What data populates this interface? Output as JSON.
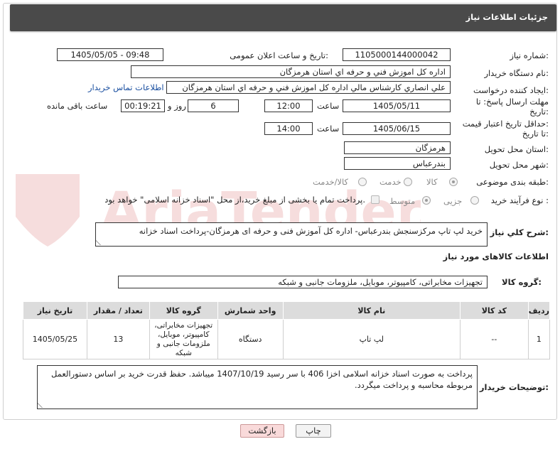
{
  "header": {
    "title": "جزئیات اطلاعات نیاز"
  },
  "fields": {
    "need_number_label": "شماره نیاز:",
    "need_number": "1105000144000042",
    "announce_label": "تاریخ و ساعت اعلان عمومی:",
    "announce_value": "1405/05/05 - 09:48",
    "buyer_org_label": "نام دستگاه خریدار:",
    "buyer_org": "اداره کل اموزش فني و حرفه اي استان هرمزگان",
    "creator_label": "ایجاد کننده درخواست:",
    "creator": "علي انصاري کارشناس مالي اداره کل اموزش فني و حرفه اي استان هرمزگان",
    "contact_link": "اطلاعات تماس خریدار",
    "deadline_label_1": "مهلت ارسال پاسخ: تا",
    "deadline_label_2": "تاریخ:",
    "deadline_date": "1405/05/11",
    "time_label": "ساعت",
    "deadline_time": "12:00",
    "days_value": "6",
    "days_label": "روز و",
    "remaining_time": "00:19:21",
    "remaining_label": "ساعت باقی مانده",
    "validity_label_1": "حداقل تاریخ اعتبار قیمت:",
    "validity_label_2": "تا تاریخ:",
    "validity_date": "1405/06/15",
    "validity_time": "14:00",
    "province_label": "استان محل تحویل:",
    "province": "هرمزگان",
    "city_label": "شهر محل تحویل:",
    "city": "بندرعباس",
    "category_label": "طبقه بندی موضوعی:",
    "category_options": [
      "کالا",
      "خدمت",
      "کالا/خدمت"
    ],
    "category_selected": "کالا",
    "process_label": "نوع فرآیند خرید :",
    "process_options": [
      "جزیی",
      "متوسط"
    ],
    "process_selected": "متوسط",
    "treasury_text": "پرداخت تمام یا بخشی از مبلغ خرید،از محل \"اسناد خزانه اسلامی\" خواهد بود."
  },
  "description": {
    "label": "شرح کلي نياز:",
    "text": "خرید لپ تاپ  مرکزسنجش بندرعباس-  اداره کل آموزش فنی و حرفه ای هرمزگان-پرداخت اسناد خزانه"
  },
  "goods": {
    "section_title": "اطلاعات کالاهای مورد نیاز",
    "group_label": "گروه کالا:",
    "group_value": "تجهیزات مخابراتی، کامپیوتر، موبایل، ملزومات جانبی و شبکه",
    "columns": [
      "ردیف",
      "کد کالا",
      "نام کالا",
      "واحد شمارش",
      "گروه کالا",
      "تعداد / مقدار",
      "تاریخ نیاز"
    ],
    "rows": [
      [
        "1",
        "--",
        "لپ تاپ",
        "دستگاه",
        "تجهیزات مخابراتی، کامپیوتر، موبایل، ملزومات جانبی و شبکه",
        "13",
        "1405/05/25"
      ]
    ]
  },
  "buyer_notes": {
    "label": "توضیحات خریدار:",
    "text": "پرداخت به صورت اسناد خزانه اسلامی اخزا  406   با سر رسید 1407/10/19 میباشد. حفظ قدرت خرید بر اساس دستورالعمل مربوطه محاسبه و پرداخت میگردد."
  },
  "buttons": {
    "print": "چاپ",
    "back": "بازگشت"
  },
  "watermark": {
    "text": "AriaTender.net",
    "icon": "aria-shield-logo"
  },
  "colors": {
    "header_bg": "#4a4a4a",
    "link": "#1a4fa0",
    "back_button_bg": "#f9dada",
    "table_header_bg": "#dcdcdc"
  }
}
